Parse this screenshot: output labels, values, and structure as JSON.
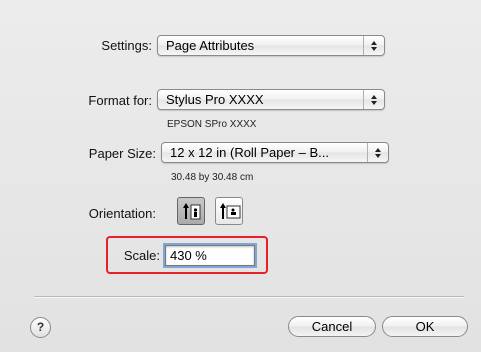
{
  "settings": {
    "label": "Settings:",
    "value": "Page Attributes"
  },
  "format_for": {
    "label": "Format for:",
    "value": "Stylus Pro XXXX",
    "sub": "EPSON SPro XXXX"
  },
  "paper_size": {
    "label": "Paper Size:",
    "value": "12 x 12 in (Roll Paper – B...",
    "dimensions": "30.48 by 30.48 cm"
  },
  "orientation": {
    "label": "Orientation:",
    "options": [
      "portrait-icon",
      "landscape-icon"
    ],
    "selected": "portrait-icon"
  },
  "scale": {
    "label": "Scale:",
    "value": "430 %",
    "highlight_color": "#e8202a"
  },
  "buttons": {
    "help": "?",
    "cancel": "Cancel",
    "ok": "OK"
  }
}
